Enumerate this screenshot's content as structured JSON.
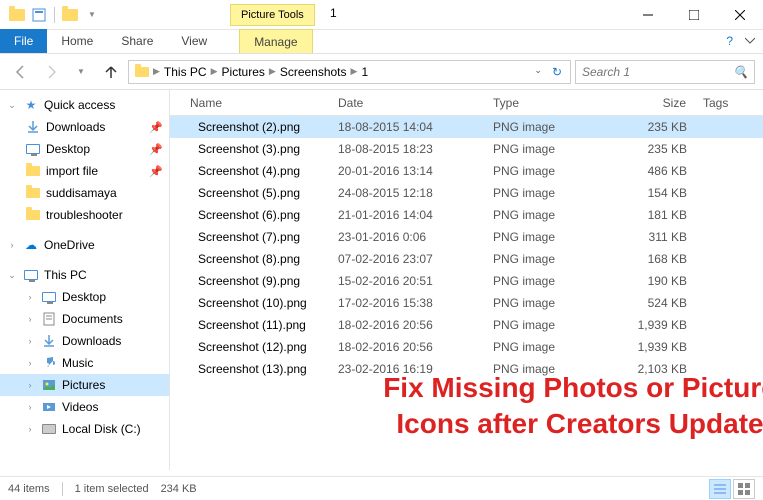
{
  "title": "1",
  "tool_tab": "Picture Tools",
  "ribbon": {
    "file": "File",
    "tabs": [
      "Home",
      "Share",
      "View"
    ],
    "context_tab": "Manage"
  },
  "breadcrumbs": [
    "This PC",
    "Pictures",
    "Screenshots",
    "1"
  ],
  "search_placeholder": "Search 1",
  "nav": {
    "quick_access": {
      "label": "Quick access",
      "items": [
        {
          "label": "Downloads",
          "pinned": true,
          "icon": "downloads"
        },
        {
          "label": "Desktop",
          "pinned": true,
          "icon": "desktop"
        },
        {
          "label": "import file",
          "pinned": true,
          "icon": "folder"
        },
        {
          "label": "suddisamaya",
          "icon": "folder"
        },
        {
          "label": "troubleshooter",
          "icon": "folder"
        }
      ]
    },
    "onedrive": {
      "label": "OneDrive"
    },
    "this_pc": {
      "label": "This PC",
      "items": [
        {
          "label": "Desktop",
          "icon": "desktop"
        },
        {
          "label": "Documents",
          "icon": "documents"
        },
        {
          "label": "Downloads",
          "icon": "downloads"
        },
        {
          "label": "Music",
          "icon": "music"
        },
        {
          "label": "Pictures",
          "icon": "pictures",
          "selected": true
        },
        {
          "label": "Videos",
          "icon": "videos"
        },
        {
          "label": "Local Disk (C:)",
          "icon": "disk"
        }
      ]
    }
  },
  "columns": {
    "name": "Name",
    "date": "Date",
    "type": "Type",
    "size": "Size",
    "tags": "Tags"
  },
  "files": [
    {
      "name": "Screenshot (2).png",
      "date": "18-08-2015 14:04",
      "type": "PNG image",
      "size": "235 KB",
      "selected": true
    },
    {
      "name": "Screenshot (3).png",
      "date": "18-08-2015 18:23",
      "type": "PNG image",
      "size": "235 KB"
    },
    {
      "name": "Screenshot (4).png",
      "date": "20-01-2016 13:14",
      "type": "PNG image",
      "size": "486 KB"
    },
    {
      "name": "Screenshot (5).png",
      "date": "24-08-2015 12:18",
      "type": "PNG image",
      "size": "154 KB"
    },
    {
      "name": "Screenshot (6).png",
      "date": "21-01-2016 14:04",
      "type": "PNG image",
      "size": "181 KB"
    },
    {
      "name": "Screenshot (7).png",
      "date": "23-01-2016 0:06",
      "type": "PNG image",
      "size": "311 KB"
    },
    {
      "name": "Screenshot (8).png",
      "date": "07-02-2016 23:07",
      "type": "PNG image",
      "size": "168 KB"
    },
    {
      "name": "Screenshot (9).png",
      "date": "15-02-2016 20:51",
      "type": "PNG image",
      "size": "190 KB"
    },
    {
      "name": "Screenshot (10).png",
      "date": "17-02-2016 15:38",
      "type": "PNG image",
      "size": "524 KB"
    },
    {
      "name": "Screenshot (11).png",
      "date": "18-02-2016 20:56",
      "type": "PNG image",
      "size": "1,939 KB"
    },
    {
      "name": "Screenshot (12).png",
      "date": "18-02-2016 20:56",
      "type": "PNG image",
      "size": "1,939 KB"
    },
    {
      "name": "Screenshot (13).png",
      "date": "23-02-2016 16:19",
      "type": "PNG image",
      "size": "2,103 KB"
    }
  ],
  "status": {
    "count": "44 items",
    "selected": "1 item selected",
    "size": "234 KB"
  },
  "overlay": "Fix Missing Photos or Picture Icons after Creators Update"
}
